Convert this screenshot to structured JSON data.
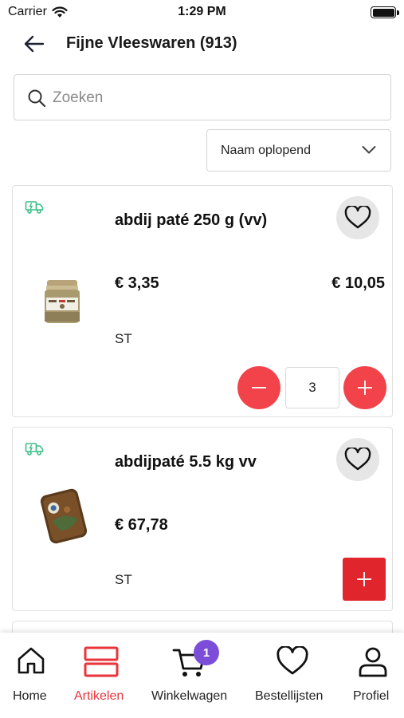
{
  "status_bar": {
    "carrier": "Carrier",
    "time": "1:29 PM"
  },
  "header": {
    "title": "Fijne Vleeswaren (913)"
  },
  "search": {
    "placeholder": "Zoeken",
    "value": ""
  },
  "sort": {
    "selected": "Naam oplopend"
  },
  "products": [
    {
      "name": "abdij paté 250 g (vv)",
      "unit_price": "€ 3,35",
      "total_price": "€ 10,05",
      "unit": "ST",
      "quantity": "3",
      "icons": {
        "delivery": "truck-icon",
        "favorite": "heart-icon"
      }
    },
    {
      "name": "abdijpaté 5.5 kg vv",
      "unit_price": "€ 67,78",
      "total_price": "",
      "unit": "ST",
      "quantity": "",
      "icons": {
        "delivery": "truck-icon",
        "favorite": "heart-icon"
      }
    }
  ],
  "tabbar": {
    "items": [
      {
        "label": "Home",
        "icon": "home-icon",
        "active": false
      },
      {
        "label": "Artikelen",
        "icon": "list-icon",
        "active": true
      },
      {
        "label": "Winkelwagen",
        "icon": "cart-icon",
        "active": false,
        "badge": "1"
      },
      {
        "label": "Bestellijsten",
        "icon": "heart-icon",
        "active": false
      },
      {
        "label": "Profiel",
        "icon": "user-icon",
        "active": false
      }
    ]
  },
  "colors": {
    "accent_red": "#f2434a",
    "add_red": "#e1252c",
    "active_tab": "#e8343b",
    "badge_purple": "#7c4dd8",
    "delivery_green": "#3fbf8a"
  }
}
